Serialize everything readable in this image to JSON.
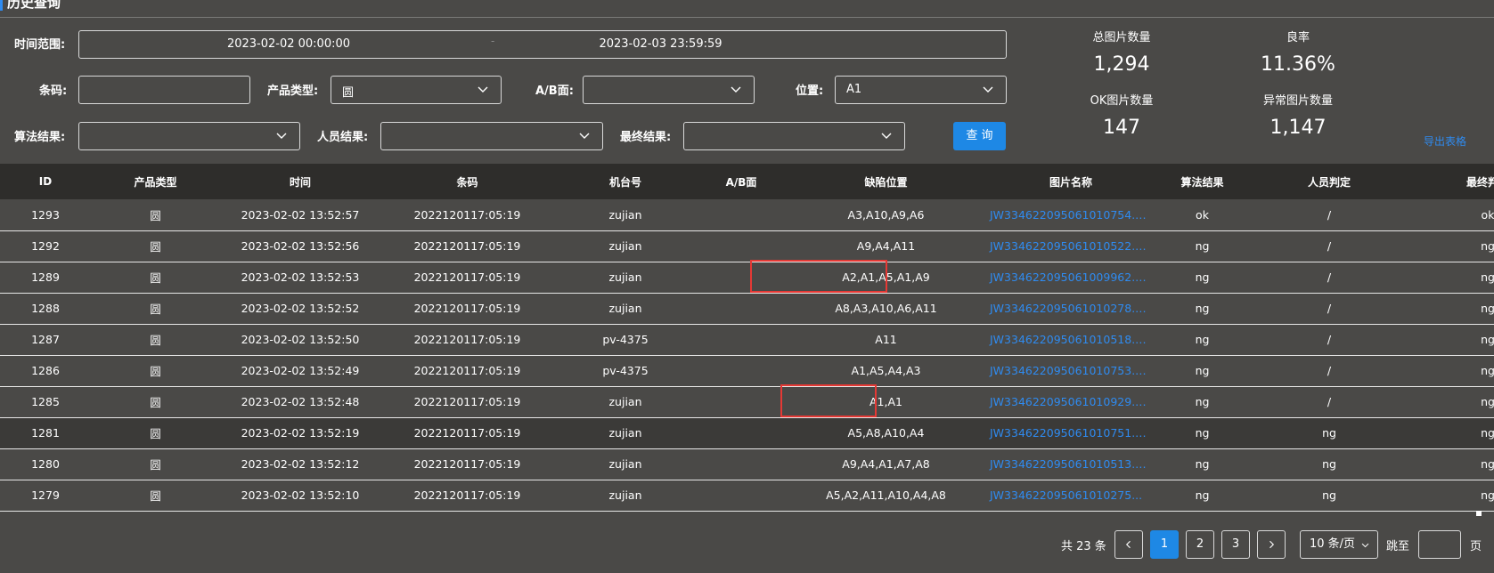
{
  "page": {
    "title": "历史查询"
  },
  "filters": {
    "time_label": "时间范围:",
    "time_start": "2023-02-02 00:00:00",
    "time_sep": "-",
    "time_end": "2023-02-03 23:59:59",
    "barcode_label": "条码:",
    "barcode_value": "",
    "product_type_label": "产品类型:",
    "product_type_value": "圆",
    "ab_label": "A/B面:",
    "ab_value": "",
    "position_label": "位置:",
    "position_value": "A1",
    "algo_label": "算法结果:",
    "algo_value": "",
    "staff_label": "人员结果:",
    "staff_value": "",
    "final_label": "最终结果:",
    "final_value": "",
    "query_label": "查 询"
  },
  "stats": {
    "total_label": "总图片数量",
    "total_value": "1,294",
    "yield_label": "良率",
    "yield_value": "11.36%",
    "ok_label": "OK图片数量",
    "ok_value": "147",
    "abnormal_label": "异常图片数量",
    "abnormal_value": "1,147",
    "export_label": "导出表格"
  },
  "table": {
    "headers": [
      "ID",
      "产品类型",
      "时间",
      "条码",
      "机台号",
      "A/B面",
      "缺陷位置",
      "图片名称",
      "算法结果",
      "人员判定",
      "最终判定"
    ],
    "rows": [
      [
        "1293",
        "圆",
        "2023-02-02 13:52:57",
        "2022120117:05:19",
        "zujian",
        "",
        "A3,A10,A9,A6",
        "JW33462209506101075​4.j...",
        "ok",
        "/",
        "ok"
      ],
      [
        "1292",
        "圆",
        "2023-02-02 13:52:56",
        "2022120117:05:19",
        "zujian",
        "",
        "A9,A4,A11",
        "JW334622095061010522.j...",
        "ng",
        "/",
        "ng"
      ],
      [
        "1289",
        "圆",
        "2023-02-02 13:52:53",
        "2022120117:05:19",
        "zujian",
        "",
        "A2,A1,A5,A1,A9",
        "JW334622095061009962.j...",
        "ng",
        "/",
        "ng"
      ],
      [
        "1288",
        "圆",
        "2023-02-02 13:52:52",
        "2022120117:05:19",
        "zujian",
        "",
        "A8,A3,A10,A6,A11",
        "JW334622095061010278.j...",
        "ng",
        "/",
        "ng"
      ],
      [
        "1287",
        "圆",
        "2023-02-02 13:52:50",
        "2022120117:05:19",
        "pv-4375",
        "",
        "A11",
        "JW334622095061010518.j...",
        "ng",
        "/",
        "ng"
      ],
      [
        "1286",
        "圆",
        "2023-02-02 13:52:49",
        "2022120117:05:19",
        "pv-4375",
        "",
        "A1,A5,A4,A3",
        "JW334622095061010753.j...",
        "ng",
        "/",
        "ng"
      ],
      [
        "1285",
        "圆",
        "2023-02-02 13:52:48",
        "2022120117:05:19",
        "zujian",
        "",
        "A1,A1",
        "JW334622095061010929.j...",
        "ng",
        "/",
        "ng"
      ],
      [
        "1281",
        "圆",
        "2023-02-02 13:52:19",
        "2022120117:05:19",
        "zujian",
        "",
        "A5,A8,A10,A4",
        "JW334622095061010751.j...",
        "ng",
        "ng",
        "ng"
      ],
      [
        "1280",
        "圆",
        "2023-02-02 13:52:12",
        "2022120117:05:19",
        "zujian",
        "",
        "A9,A4,A1,A7,A8",
        "JW334622095061010513.j...",
        "ng",
        "ng",
        "ng"
      ],
      [
        "1279",
        "圆",
        "2023-02-02 13:52:10",
        "2022120117:05:19",
        "zujian",
        "",
        "A5,A2,A11,A10,A4,A8",
        "JW334622095061010275...",
        "ng",
        "ng",
        "ng"
      ]
    ]
  },
  "pagination": {
    "total_text": "共 23 条",
    "pages": [
      "1",
      "2",
      "3"
    ],
    "current_page": "1",
    "page_size": "10 条/页",
    "jump_label": "跳至",
    "page_suffix": "页"
  },
  "colors": {
    "accent": "#1e88e5",
    "link": "#2f8bf0",
    "highlight_box": "#e53935",
    "bg": "#4a4947",
    "header_bg": "#2e2d2b"
  }
}
